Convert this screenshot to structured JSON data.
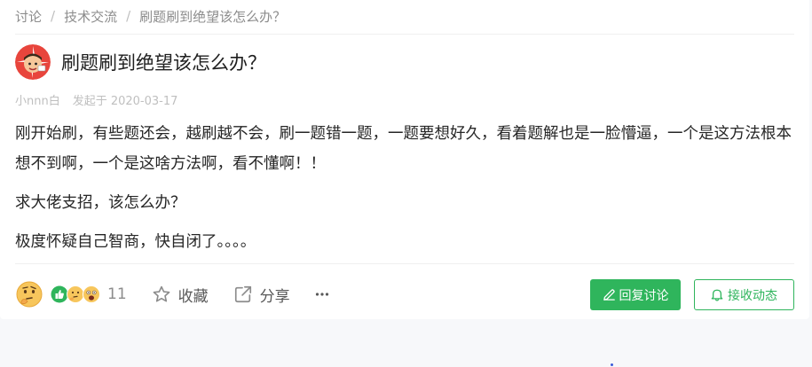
{
  "breadcrumb": {
    "items": [
      "讨论",
      "技术交流",
      "刷题刷到绝望该怎么办？"
    ],
    "separator": "/"
  },
  "post": {
    "title": "刷题刷到绝望该怎么办？",
    "author": "小nnn白",
    "date_text": "发起于 2020-03-17",
    "paragraphs": [
      "刚开始刷，有些题还会，越刷越不会，刷一题错一题，一题要想好久，看着题解也是一脸懵逼，一个是这方法根本想不到啊，一个是这啥方法啊，看不懂啊！！",
      "求大佬支招，该怎么办？",
      "极度怀疑自己智商，快自闭了。。。。"
    ]
  },
  "actions": {
    "reaction_count": "11",
    "collect_label": "收藏",
    "share_label": "分享",
    "more_label": "···",
    "reply_label": "回复讨论",
    "follow_label": "接收动态"
  },
  "colors": {
    "accent": "#2fb55c",
    "muted": "#8c8c8c",
    "meta": "#bfbfbf"
  },
  "icons": {
    "avatar": "cartoon-avatar",
    "react_trigger": "thinking-emoji-icon",
    "reactions": [
      "thumbs-up-icon",
      "thinking-face-icon",
      "astonished-face-icon"
    ],
    "collect": "star-icon",
    "share": "share-arrow-icon",
    "more": "ellipsis-icon",
    "reply": "pencil-icon",
    "follow": "bell-icon"
  }
}
